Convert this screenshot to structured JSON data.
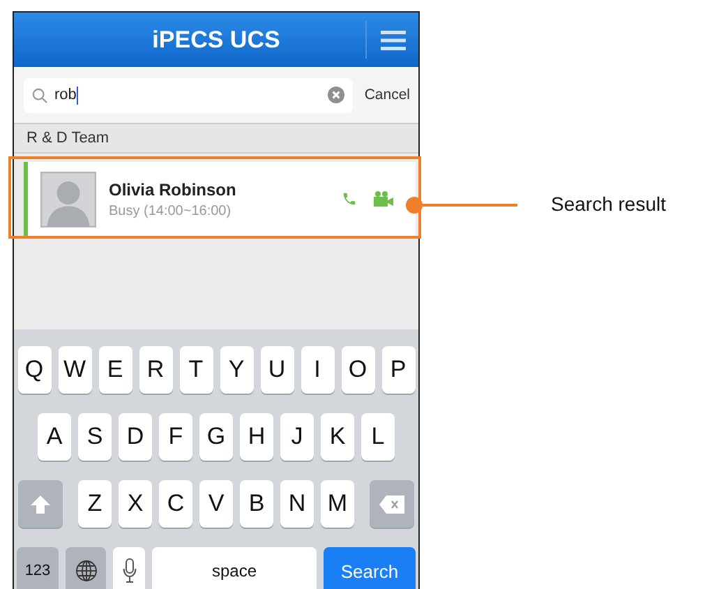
{
  "header": {
    "title": "iPECS UCS"
  },
  "search": {
    "value": "rob",
    "cancel": "Cancel"
  },
  "section": {
    "title": "R & D Team"
  },
  "results": [
    {
      "name": "Olivia Robinson",
      "status": "Busy (14:00~16:00)",
      "color": "#6cc04a"
    }
  ],
  "keyboard": {
    "top_row": [
      {
        "kind": "letter",
        "label": "Q"
      },
      {
        "kind": "letter",
        "label": "W"
      },
      {
        "kind": "letter",
        "label": "E"
      },
      {
        "kind": "letter",
        "label": "R"
      },
      {
        "kind": "letter",
        "label": "T"
      },
      {
        "kind": "letter",
        "label": "Y"
      },
      {
        "kind": "letter",
        "label": "U"
      },
      {
        "kind": "letter",
        "label": "I"
      },
      {
        "kind": "letter",
        "label": "O"
      },
      {
        "kind": "letter",
        "label": "P"
      }
    ],
    "middle_row": [
      {
        "kind": "letter",
        "label": "A"
      },
      {
        "kind": "letter",
        "label": "S"
      },
      {
        "kind": "letter",
        "label": "D"
      },
      {
        "kind": "letter",
        "label": "F"
      },
      {
        "kind": "letter",
        "label": "G"
      },
      {
        "kind": "letter",
        "label": "H"
      },
      {
        "kind": "letter",
        "label": "J"
      },
      {
        "kind": "letter",
        "label": "K"
      },
      {
        "kind": "letter",
        "label": "L"
      }
    ],
    "bottom_row": [
      {
        "kind": "shift"
      },
      {
        "kind": "letter",
        "label": "Z"
      },
      {
        "kind": "letter",
        "label": "X"
      },
      {
        "kind": "letter",
        "label": "C"
      },
      {
        "kind": "letter",
        "label": "V"
      },
      {
        "kind": "letter",
        "label": "B"
      },
      {
        "kind": "letter",
        "label": "N"
      },
      {
        "kind": "letter",
        "label": "M"
      },
      {
        "kind": "backspace"
      }
    ],
    "function_row": [
      {
        "kind": "mode",
        "label": "123"
      },
      {
        "kind": "globe"
      },
      {
        "kind": "mic"
      },
      {
        "kind": "space",
        "label": "space"
      },
      {
        "kind": "action",
        "label": "Search"
      }
    ]
  },
  "annotation": {
    "label": "Search result"
  }
}
